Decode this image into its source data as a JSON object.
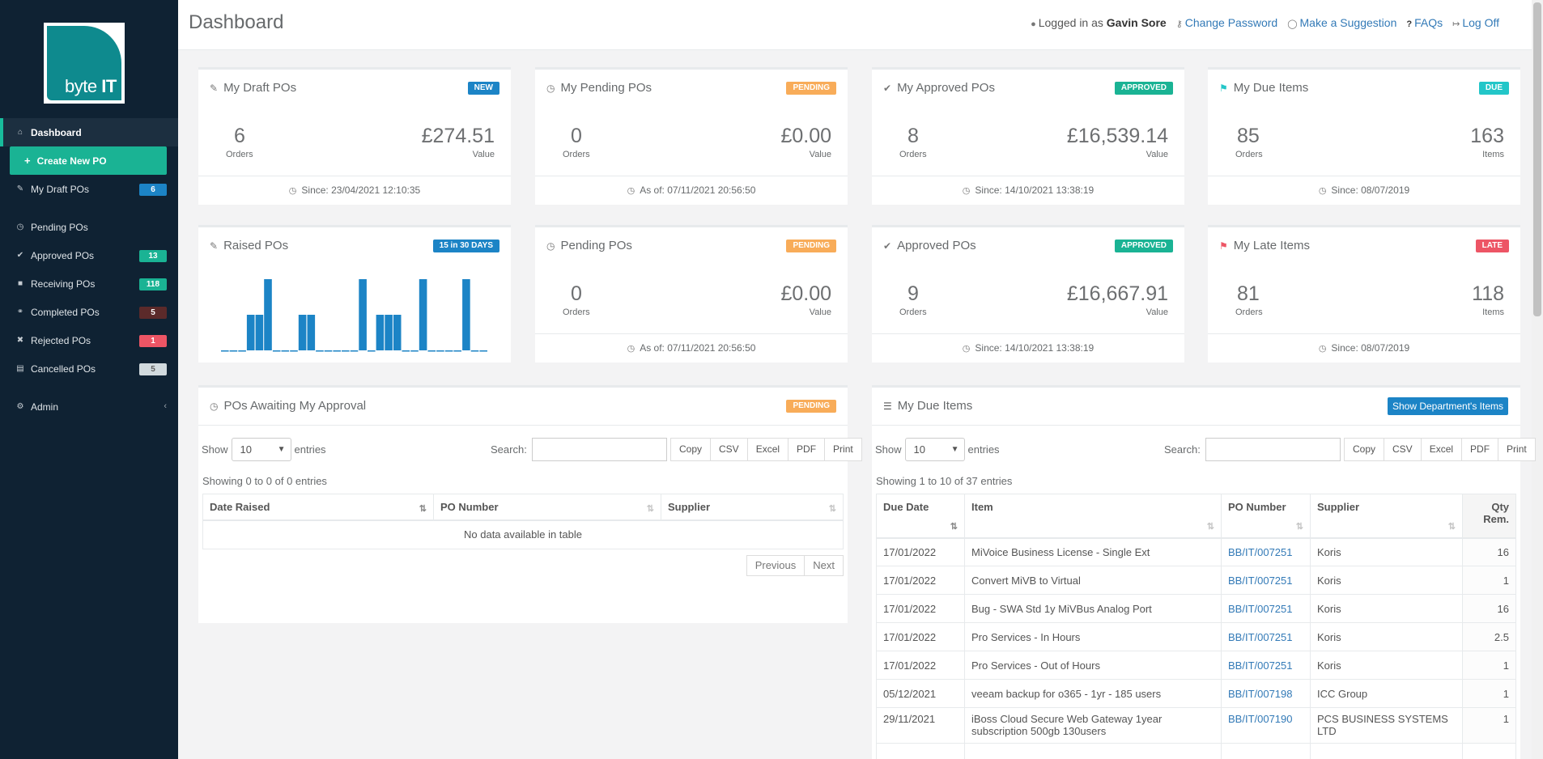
{
  "app": {
    "logo_text_a": "byte",
    "logo_text_b": "IT"
  },
  "colors": {
    "sidebar": "#0f2233",
    "accent": "#1ab394",
    "blue": "#1c84c6",
    "orange": "#f8ac59",
    "red": "#ed5565",
    "dark": "#5b2a2a"
  },
  "sidebar": {
    "items": [
      {
        "label": "Dashboard",
        "icon": "home-icon"
      },
      {
        "label": "Create New PO",
        "icon": "plus-icon"
      },
      {
        "label": "My Draft POs",
        "icon": "pencil-icon",
        "badge": "6"
      },
      {
        "label": "Pending POs",
        "icon": "clock-icon"
      },
      {
        "label": "Approved POs",
        "icon": "check-icon",
        "badge": "13"
      },
      {
        "label": "Receiving POs",
        "icon": "truck-icon",
        "badge": "118"
      },
      {
        "label": "Completed POs",
        "icon": "handshake-icon",
        "badge": "5"
      },
      {
        "label": "Rejected POs",
        "icon": "x-icon",
        "badge": "1"
      },
      {
        "label": "Cancelled POs",
        "icon": "trash-icon",
        "badge": "5"
      },
      {
        "label": "Admin",
        "icon": "gear-icon"
      }
    ]
  },
  "header": {
    "title": "Dashboard",
    "logged_prefix": "Logged in as",
    "user": "Gavin Sore",
    "change_password": "Change Password",
    "suggestion": "Make a Suggestion",
    "faqs": "FAQs",
    "logoff": "Log Off"
  },
  "cards": {
    "draft": {
      "title": "My Draft POs",
      "label": "NEW",
      "count": "6",
      "count_cap": "Orders",
      "value": "£274.51",
      "value_cap": "Value",
      "foot": "Since: 23/04/2021 12:10:35"
    },
    "my_pending": {
      "title": "My Pending POs",
      "label": "PENDING",
      "count": "0",
      "count_cap": "Orders",
      "value": "£0.00",
      "value_cap": "Value",
      "foot": "As of: 07/11/2021 20:56:50"
    },
    "my_approved": {
      "title": "My Approved POs",
      "label": "APPROVED",
      "count": "8",
      "count_cap": "Orders",
      "value": "£16,539.14",
      "value_cap": "Value",
      "foot": "Since: 14/10/2021 13:38:19"
    },
    "my_due": {
      "title": "My Due Items",
      "label": "DUE",
      "count": "85",
      "count_cap": "Orders",
      "value": "163",
      "value_cap": "Items",
      "foot": "Since: 08/07/2019"
    },
    "raised": {
      "title": "Raised POs",
      "label": "15 in 30 DAYS"
    },
    "pending": {
      "title": "Pending POs",
      "label": "PENDING",
      "count": "0",
      "count_cap": "Orders",
      "value": "£0.00",
      "value_cap": "Value",
      "foot": "As of: 07/11/2021 20:56:50"
    },
    "approved": {
      "title": "Approved POs",
      "label": "APPROVED",
      "count": "9",
      "count_cap": "Orders",
      "value": "£16,667.91",
      "value_cap": "Value",
      "foot": "Since: 14/10/2021 13:38:19"
    },
    "late": {
      "title": "My Late Items",
      "label": "LATE",
      "count": "81",
      "count_cap": "Orders",
      "value": "118",
      "value_cap": "Items",
      "foot": "Since: 08/07/2019"
    }
  },
  "chart_data": {
    "type": "bar",
    "values": [
      0,
      0,
      0,
      1,
      1,
      2,
      0,
      0,
      0,
      1,
      1,
      0,
      0,
      0,
      0,
      0,
      2,
      0,
      1,
      1,
      1,
      0,
      0,
      2,
      0,
      0,
      0,
      0,
      2,
      0,
      0
    ],
    "ylim": [
      0,
      2
    ]
  },
  "approval": {
    "title": "POs Awaiting My Approval",
    "label": "PENDING",
    "show": "Show",
    "entries_value": "10",
    "entries": "entries",
    "search": "Search:",
    "buttons": [
      "Copy",
      "CSV",
      "Excel",
      "PDF",
      "Print"
    ],
    "info": "Showing 0 to 0 of 0 entries",
    "columns": [
      "Date Raised",
      "PO Number",
      "Supplier"
    ],
    "empty": "No data available in table",
    "prev": "Previous",
    "next": "Next"
  },
  "due": {
    "title": "My Due Items",
    "dept_button": "Show Department's Items",
    "show": "Show",
    "entries_value": "10",
    "entries": "entries",
    "search": "Search:",
    "buttons": [
      "Copy",
      "CSV",
      "Excel",
      "PDF",
      "Print"
    ],
    "info": "Showing 1 to 10 of 37 entries",
    "columns": [
      "Due Date",
      "Item",
      "PO Number",
      "Supplier",
      "Qty Rem."
    ],
    "rows": [
      [
        "17/01/2022",
        "MiVoice Business License - Single Ext",
        "BB/IT/007251",
        "Koris",
        "16"
      ],
      [
        "17/01/2022",
        "Convert MiVB to Virtual",
        "BB/IT/007251",
        "Koris",
        "1"
      ],
      [
        "17/01/2022",
        "Bug - SWA Std 1y MiVBus Analog Port",
        "BB/IT/007251",
        "Koris",
        "16"
      ],
      [
        "17/01/2022",
        "Pro Services - In Hours",
        "BB/IT/007251",
        "Koris",
        "2.5"
      ],
      [
        "17/01/2022",
        "Pro Services - Out of Hours",
        "BB/IT/007251",
        "Koris",
        "1"
      ],
      [
        "05/12/2021",
        "veeam backup for o365 - 1yr - 185 users",
        "BB/IT/007198",
        "ICC Group",
        "1"
      ],
      [
        "29/11/2021",
        "iBoss Cloud Secure Web Gateway 1year subscription 500gb 130users",
        "BB/IT/007190",
        "PCS BUSINESS SYSTEMS LTD",
        "1"
      ]
    ]
  }
}
